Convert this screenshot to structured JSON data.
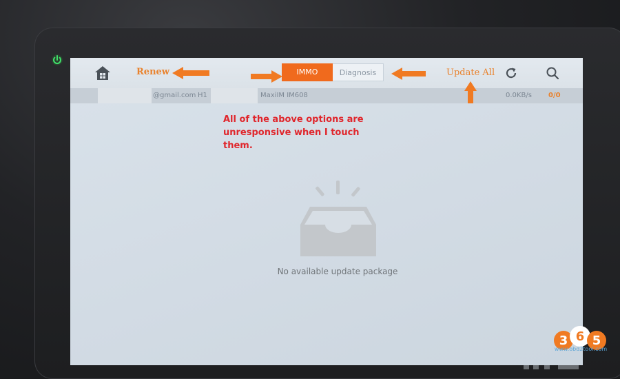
{
  "device": {
    "power_icon": "power-icon"
  },
  "topbar": {
    "home_icon": "home-icon",
    "renew_label": "Renew",
    "tabs": [
      {
        "label": "IMMO",
        "active": true
      },
      {
        "label": "Diagnosis",
        "active": false
      }
    ],
    "update_all_label": "Update All",
    "refresh_icon": "refresh-icon",
    "search_icon": "search-icon"
  },
  "info": {
    "email": "@gmail.com",
    "serial_prefix": "H1",
    "device": "MaxiIM IM608",
    "speed": "0.0KB/s",
    "count": "0/0"
  },
  "annotation": {
    "line1": "All of the above options are",
    "line2": "unresponsive when I touch them."
  },
  "empty_state": {
    "icon": "empty-inbox-icon",
    "message": "No available update package"
  },
  "colors": {
    "accent": "#f06a1d",
    "annotation": "#e0262c",
    "arrow": "#f07a22"
  },
  "logo": {
    "text": "365",
    "site": "www.obd2tool.com"
  }
}
